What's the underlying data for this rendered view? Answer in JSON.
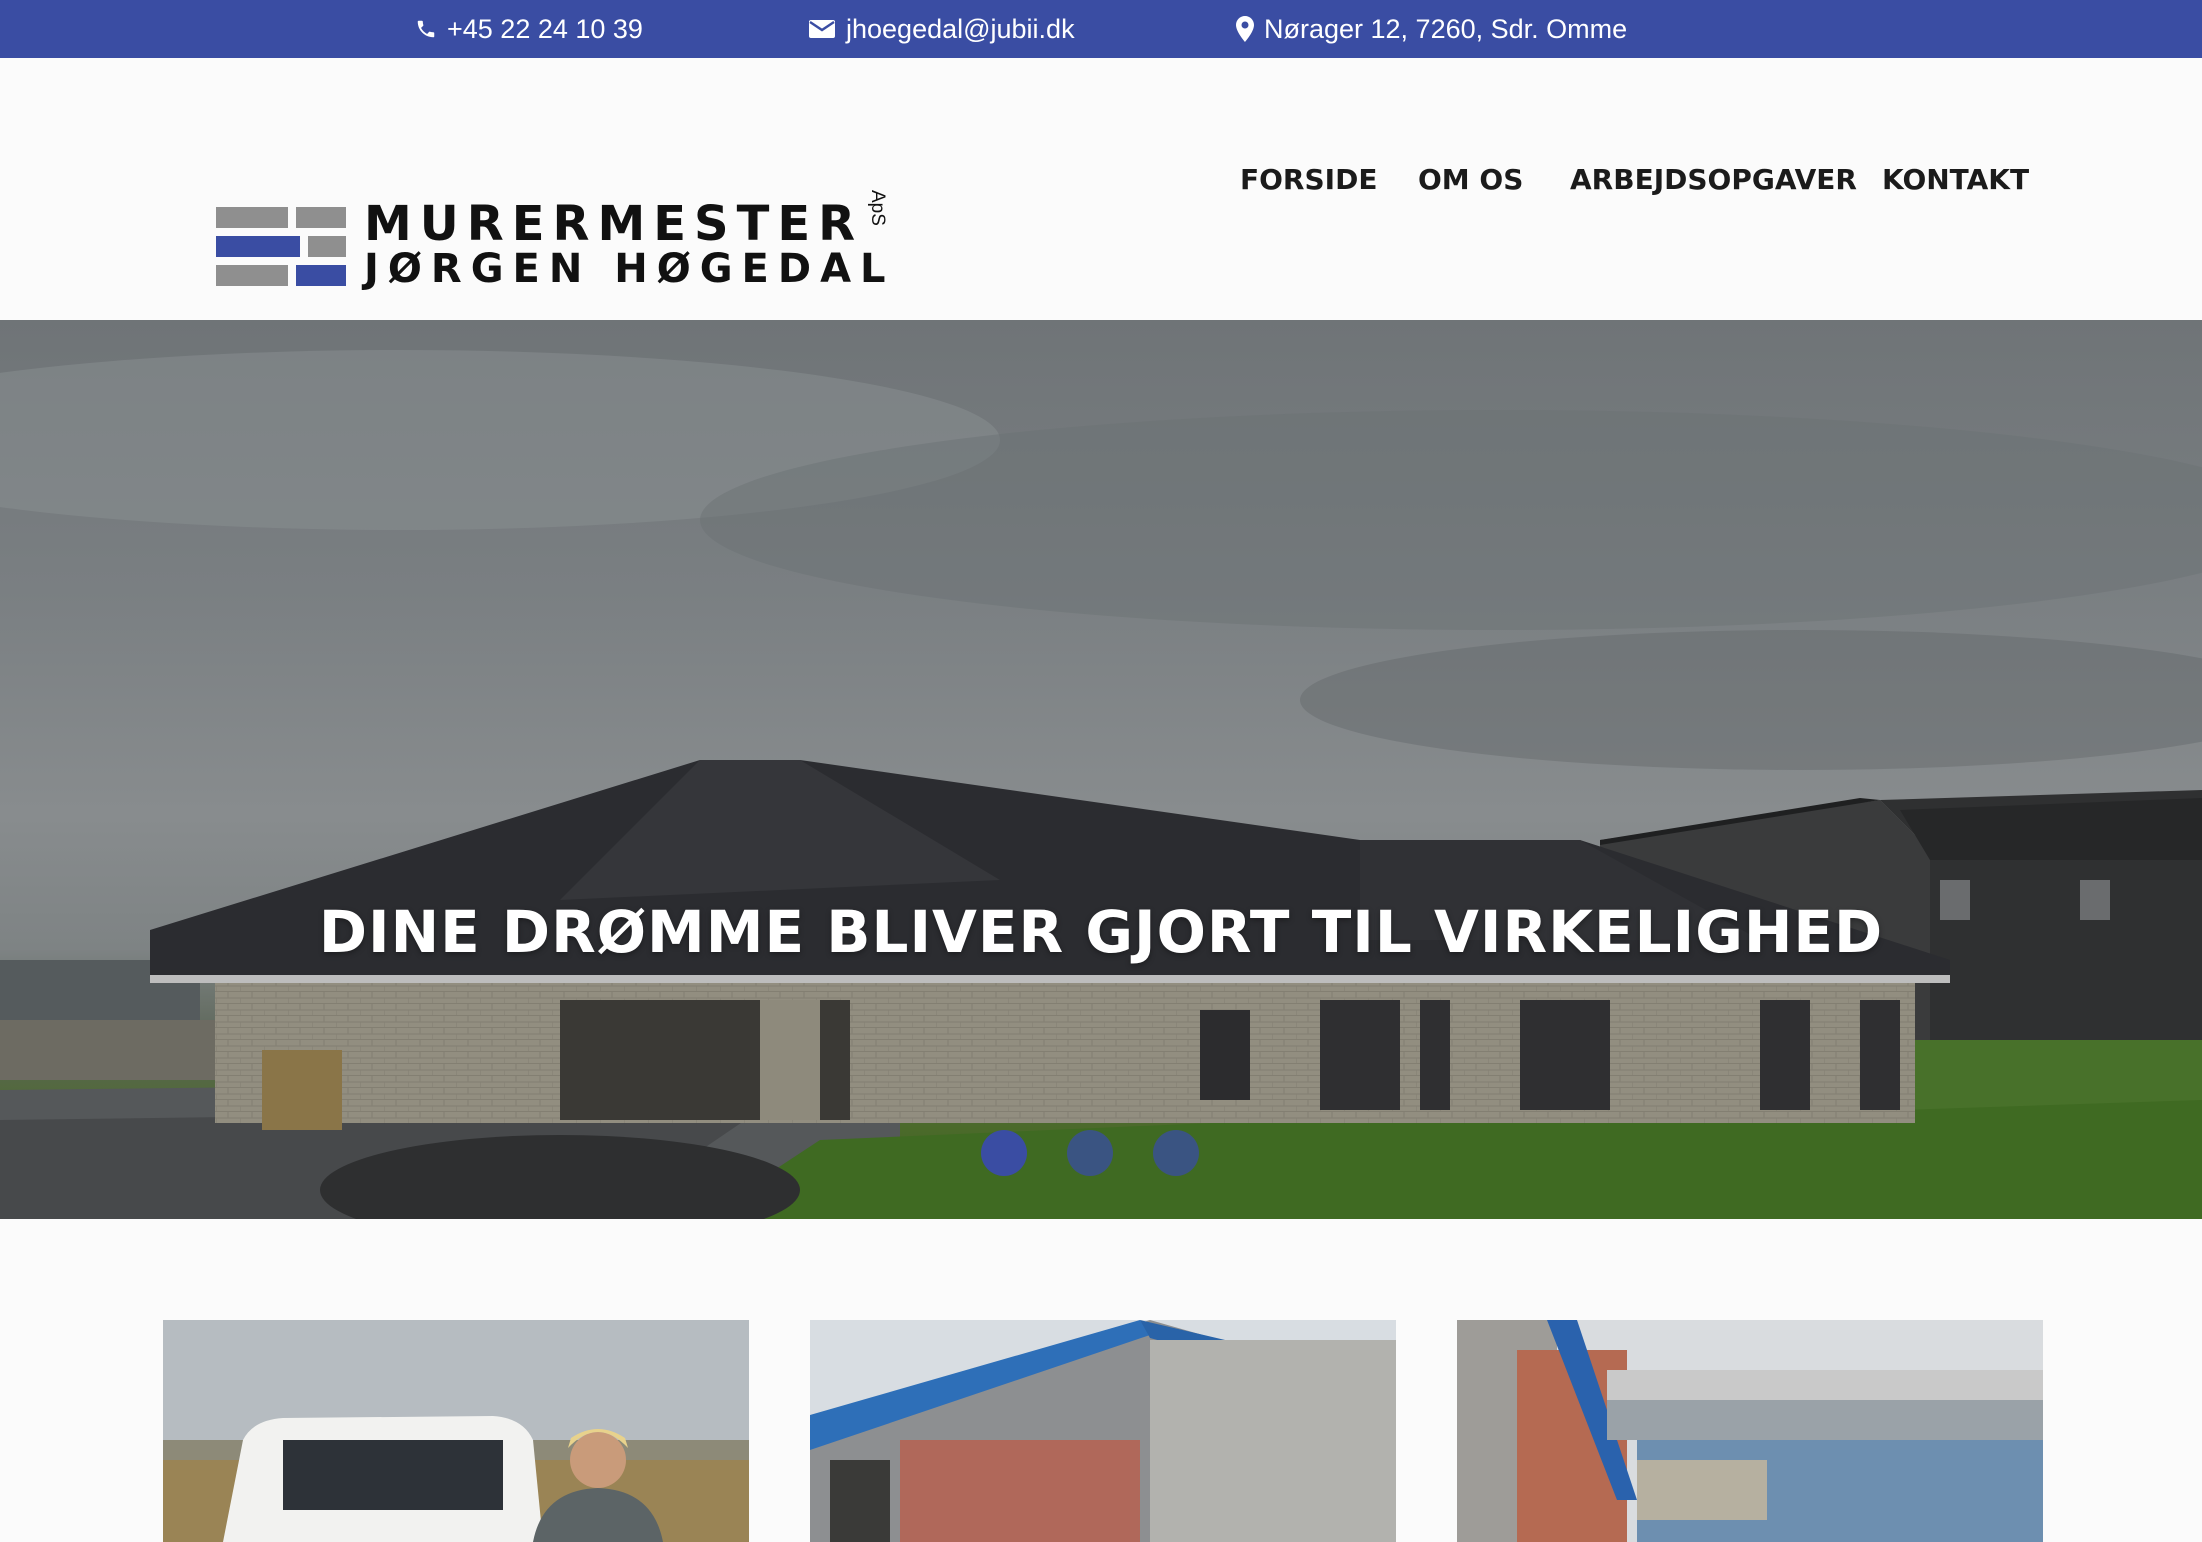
{
  "topbar": {
    "background": "#3a4da3",
    "phone": "+45 22 24 10 39",
    "email": "jhoegedal@jubii.dk",
    "address": "Nørager 12, 7260, Sdr. Omme"
  },
  "logo": {
    "line1": "MURERMESTER",
    "line2": "JØRGEN HØGEDAL",
    "suffix": "ApS",
    "brick_gray": "#8f8f8f",
    "brick_blue": "#3a4da3"
  },
  "nav": {
    "items": [
      {
        "label": "FORSIDE"
      },
      {
        "label": "OM OS"
      },
      {
        "label": "ARBEJDSOPGAVER"
      },
      {
        "label": "KONTAKT"
      }
    ]
  },
  "hero": {
    "title": "DINE DRØMME BLIVER GJORT TIL VIRKELIGHED",
    "slides": 3,
    "active_slide": 1,
    "dot_color": "#3a4da3"
  },
  "cards": {
    "count": 3
  }
}
